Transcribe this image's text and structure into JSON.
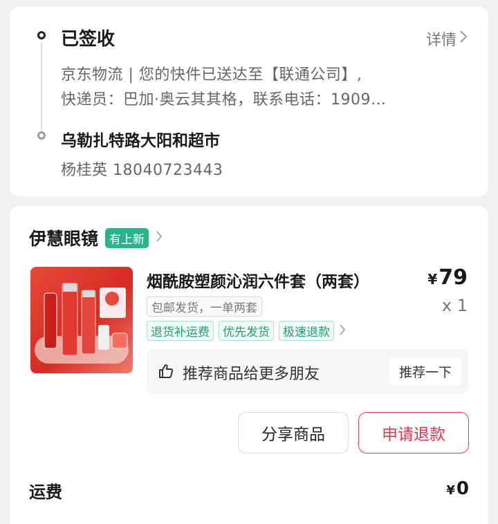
{
  "logistics": {
    "status": "已签收",
    "detail_link": "详情",
    "ship_line_1": "京东物流 | 您的快件已送达至【联通公司】,",
    "ship_line_2": "快递员：巴加·奥云其其格，联系电话：1909…",
    "address": "乌勒扎特路大阳和超市",
    "contact": "杨桂英 18040723443"
  },
  "order": {
    "shop_name": "伊慧眼镜",
    "shop_badge": "有上新",
    "product_title": "烟酰胺塑颜沁润六件套（两套）",
    "price_symbol": "¥",
    "price": "79",
    "quantity": "x 1",
    "spec": "包邮发货，一单两套",
    "services": [
      "退货补运费",
      "优先发货",
      "极速退款"
    ],
    "recommend_text": "推荐商品给更多朋友",
    "recommend_button": "推荐一下",
    "share_button": "分享商品",
    "refund_button": "申请退款",
    "shipping_fee_label": "运费",
    "shipping_fee_symbol": "¥",
    "shipping_fee_value": "0"
  },
  "colors": {
    "accent_green": "#2bb48a",
    "refund_red": "#e8334a",
    "product_red": "#d62b22"
  },
  "icons": {
    "detail_chevron": "chevron-right-icon",
    "recommend": "thumbs-up-icon"
  }
}
